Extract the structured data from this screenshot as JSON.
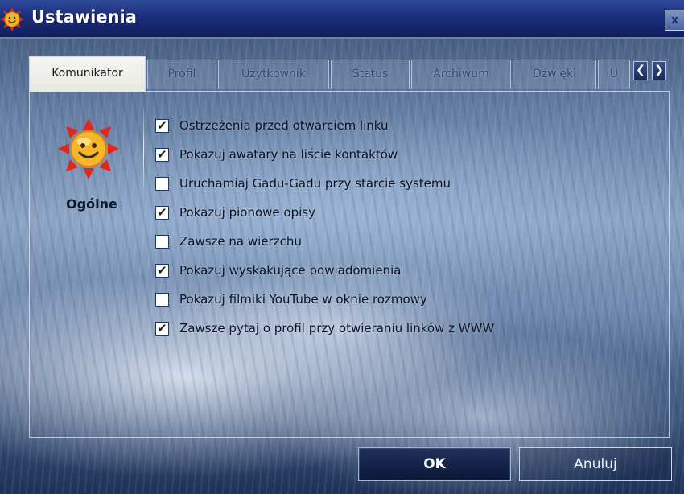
{
  "window": {
    "title": "Ustawienia",
    "close_label": "x",
    "app_icon": "gadu-gadu-sun-icon"
  },
  "tabs": [
    {
      "label": "Komunikator",
      "active": true
    },
    {
      "label": "Profil",
      "active": false
    },
    {
      "label": "Użytkownik",
      "active": false
    },
    {
      "label": "Status",
      "active": false
    },
    {
      "label": "Archiwum",
      "active": false
    },
    {
      "label": "Dźwięki",
      "active": false
    },
    {
      "label": "U",
      "active": false
    }
  ],
  "tab_scroll": {
    "left": "❮",
    "right": "❯"
  },
  "category": {
    "label": "Ogólne",
    "icon": "sun-icon"
  },
  "options": [
    {
      "label": "Ostrzeżenia przed otwarciem linku",
      "checked": true
    },
    {
      "label": "Pokazuj awatary na liście kontaktów",
      "checked": true
    },
    {
      "label": "Uruchamiaj Gadu-Gadu przy starcie systemu",
      "checked": false
    },
    {
      "label": "Pokazuj pionowe opisy",
      "checked": true
    },
    {
      "label": "Zawsze na wierzchu",
      "checked": false
    },
    {
      "label": "Pokazuj wyskakujące powiadomienia",
      "checked": true
    },
    {
      "label": "Pokazuj filmiki YouTube w oknie rozmowy",
      "checked": false
    },
    {
      "label": "Zawsze pytaj o profil przy otwieraniu linków z WWW",
      "checked": true
    }
  ],
  "buttons": {
    "ok": "OK",
    "cancel": "Anuluj"
  },
  "colors": {
    "title_bar": "#1c2f7c",
    "sun": "#f5a623",
    "sun_rays": "#e0231b"
  }
}
